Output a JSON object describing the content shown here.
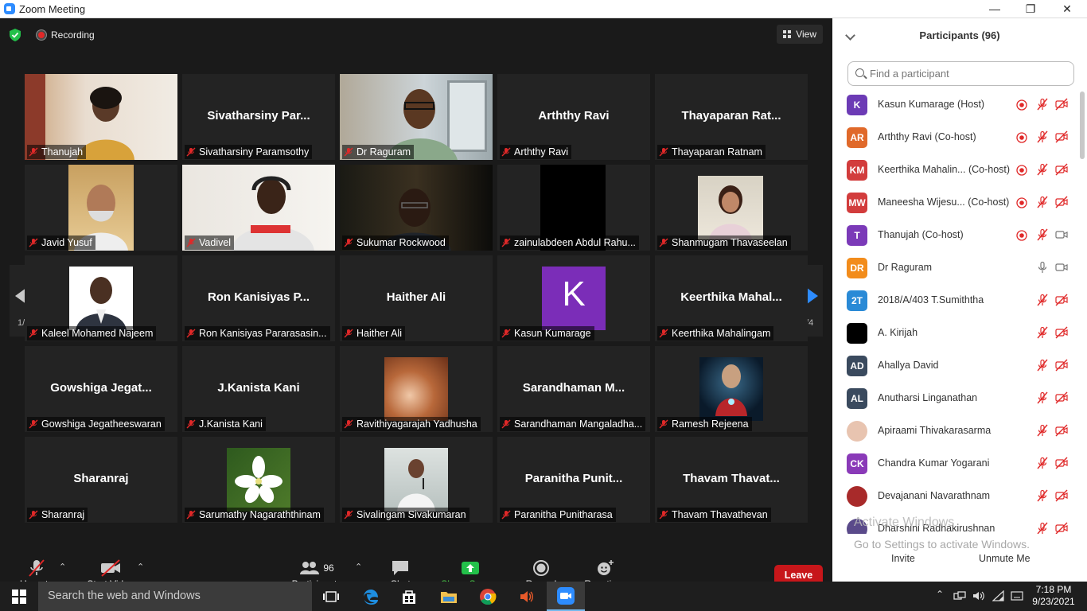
{
  "window": {
    "title": "Zoom Meeting",
    "minimize": "—",
    "restore": "❐",
    "close": "✕"
  },
  "meeting": {
    "recording_label": "Recording",
    "view_label": "View",
    "page_left": "1/4",
    "page_right": "1/4"
  },
  "tiles": [
    {
      "name": "Thanujah",
      "big": "",
      "photo": "thanujah"
    },
    {
      "name": "Sivatharsiny Paramsothy",
      "big": "Sivatharsiny  Par...",
      "photo": ""
    },
    {
      "name": "Dr Raguram",
      "big": "",
      "photo": "raguram",
      "active": true
    },
    {
      "name": "Arththy Ravi",
      "big": "Arththy Ravi",
      "photo": ""
    },
    {
      "name": "Thayaparan Ratnam",
      "big": "Thayaparan  Rat...",
      "photo": ""
    },
    {
      "name": "Javid Yusuf",
      "big": "",
      "photo": "javid"
    },
    {
      "name": "Vadivel",
      "big": "",
      "photo": "vadivel"
    },
    {
      "name": "Sukumar Rockwood",
      "big": "",
      "photo": "sukumar"
    },
    {
      "name": "zainulabdeen Abdul Rahu...",
      "big": "",
      "photo": "black"
    },
    {
      "name": "Shanmugam Thavaseelan",
      "big": "",
      "photo": "girl"
    },
    {
      "name": "Kaleel Mohamed Najeem",
      "big": "",
      "photo": "kaleel"
    },
    {
      "name": "Ron Kanisiyas Pararasasin...",
      "big": "Ron  Kanisiyas  P...",
      "photo": ""
    },
    {
      "name": "Haither Ali",
      "big": "Haither Ali",
      "photo": ""
    },
    {
      "name": "Kasun Kumarage",
      "big": "",
      "photo": "k"
    },
    {
      "name": "Keerthika Mahalingam",
      "big": "Keerthika  Mahal...",
      "photo": ""
    },
    {
      "name": "Gowshiga Jegatheeswaran",
      "big": "Gowshiga  Jegat...",
      "photo": ""
    },
    {
      "name": "J.Kanista Kani",
      "big": "J.Kanista Kani",
      "photo": ""
    },
    {
      "name": "Ravithiyagarajah Yadhusha",
      "big": "",
      "photo": "hair"
    },
    {
      "name": "Sarandhaman Mangaladha...",
      "big": "Sarandhaman  M...",
      "photo": ""
    },
    {
      "name": "Ramesh Rejeena",
      "big": "",
      "photo": "ironman"
    },
    {
      "name": "Sharanraj",
      "big": "Sharanraj",
      "photo": ""
    },
    {
      "name": "Sarumathy Nagaraththinam",
      "big": "",
      "photo": "flower"
    },
    {
      "name": "Sivalingam Sivakumaran",
      "big": "",
      "photo": "speaker"
    },
    {
      "name": "Paranitha Punitharasa",
      "big": "Paranitha  Punit...",
      "photo": ""
    },
    {
      "name": "Thavam Thavathevan",
      "big": "Thavam  Thavat...",
      "photo": ""
    }
  ],
  "k_letter": "K",
  "toolbar": {
    "unmute": "Unmute",
    "start_video": "Start Video",
    "participants": "Participants",
    "participants_count": "96",
    "chat": "Chat",
    "share_screen": "Share Screen",
    "record": "Record",
    "reactions": "Reactions",
    "leave": "Leave"
  },
  "panel": {
    "header": "Participants (96)",
    "search_placeholder": "Find a participant",
    "invite": "Invite",
    "unmute_me": "Unmute Me",
    "watermark_title": "Activate Windows",
    "watermark_sub": "Go to Settings to activate Windows.",
    "participants": [
      {
        "initials": "K",
        "color": "#6c3bb5",
        "name": "Kasun Kumarage (Host)",
        "rec": true,
        "mic": "muted",
        "video": "off"
      },
      {
        "initials": "AR",
        "color": "#e0692a",
        "name": "Arththy Ravi (Co-host)",
        "rec": true,
        "mic": "muted",
        "video": "off"
      },
      {
        "initials": "KM",
        "color": "#d23c3c",
        "name": "Keerthika Mahalin... (Co-host)",
        "rec": true,
        "mic": "muted",
        "video": "off"
      },
      {
        "initials": "MW",
        "color": "#d23c3c",
        "name": "Maneesha Wijesu... (Co-host)",
        "rec": true,
        "mic": "muted",
        "video": "off"
      },
      {
        "initials": "T",
        "color": "#7b3ab8",
        "name": "Thanujah (Co-host)",
        "rec": true,
        "mic": "muted",
        "video": "on"
      },
      {
        "initials": "DR",
        "color": "#f28c1b",
        "name": "Dr Raguram",
        "rec": false,
        "mic": "on",
        "video": "on"
      },
      {
        "initials": "2T",
        "color": "#2a8ad6",
        "name": "2018/A/403 T.Sumiththa",
        "rec": false,
        "mic": "muted",
        "video": "off"
      },
      {
        "initials": "",
        "color": "#000000",
        "name": "A. Kirijah",
        "rec": false,
        "mic": "muted",
        "video": "off"
      },
      {
        "initials": "AD",
        "color": "#3a4a5e",
        "name": "Ahallya David",
        "rec": false,
        "mic": "muted",
        "video": "off"
      },
      {
        "initials": "AL",
        "color": "#3a4a5e",
        "name": "Anutharsi Linganathan",
        "rec": false,
        "mic": "muted",
        "video": "off"
      },
      {
        "initials": "",
        "color": "#e8c4b0",
        "name": "Apiraami Thivakarasarma",
        "rec": false,
        "mic": "muted",
        "video": "off"
      },
      {
        "initials": "CK",
        "color": "#8a3ab8",
        "name": "Chandra Kumar Yogarani",
        "rec": false,
        "mic": "muted",
        "video": "off"
      },
      {
        "initials": "",
        "color": "#a82a2a",
        "name": "Devajanani Navarathnam",
        "rec": false,
        "mic": "muted",
        "video": "off"
      },
      {
        "initials": "",
        "color": "#5a4a8a",
        "name": "Dharshini Radhakirushnan",
        "rec": false,
        "mic": "muted",
        "video": "off"
      }
    ]
  },
  "taskbar": {
    "search": "Search the web and Windows",
    "time": "7:18 PM",
    "date": "9/23/2021"
  }
}
